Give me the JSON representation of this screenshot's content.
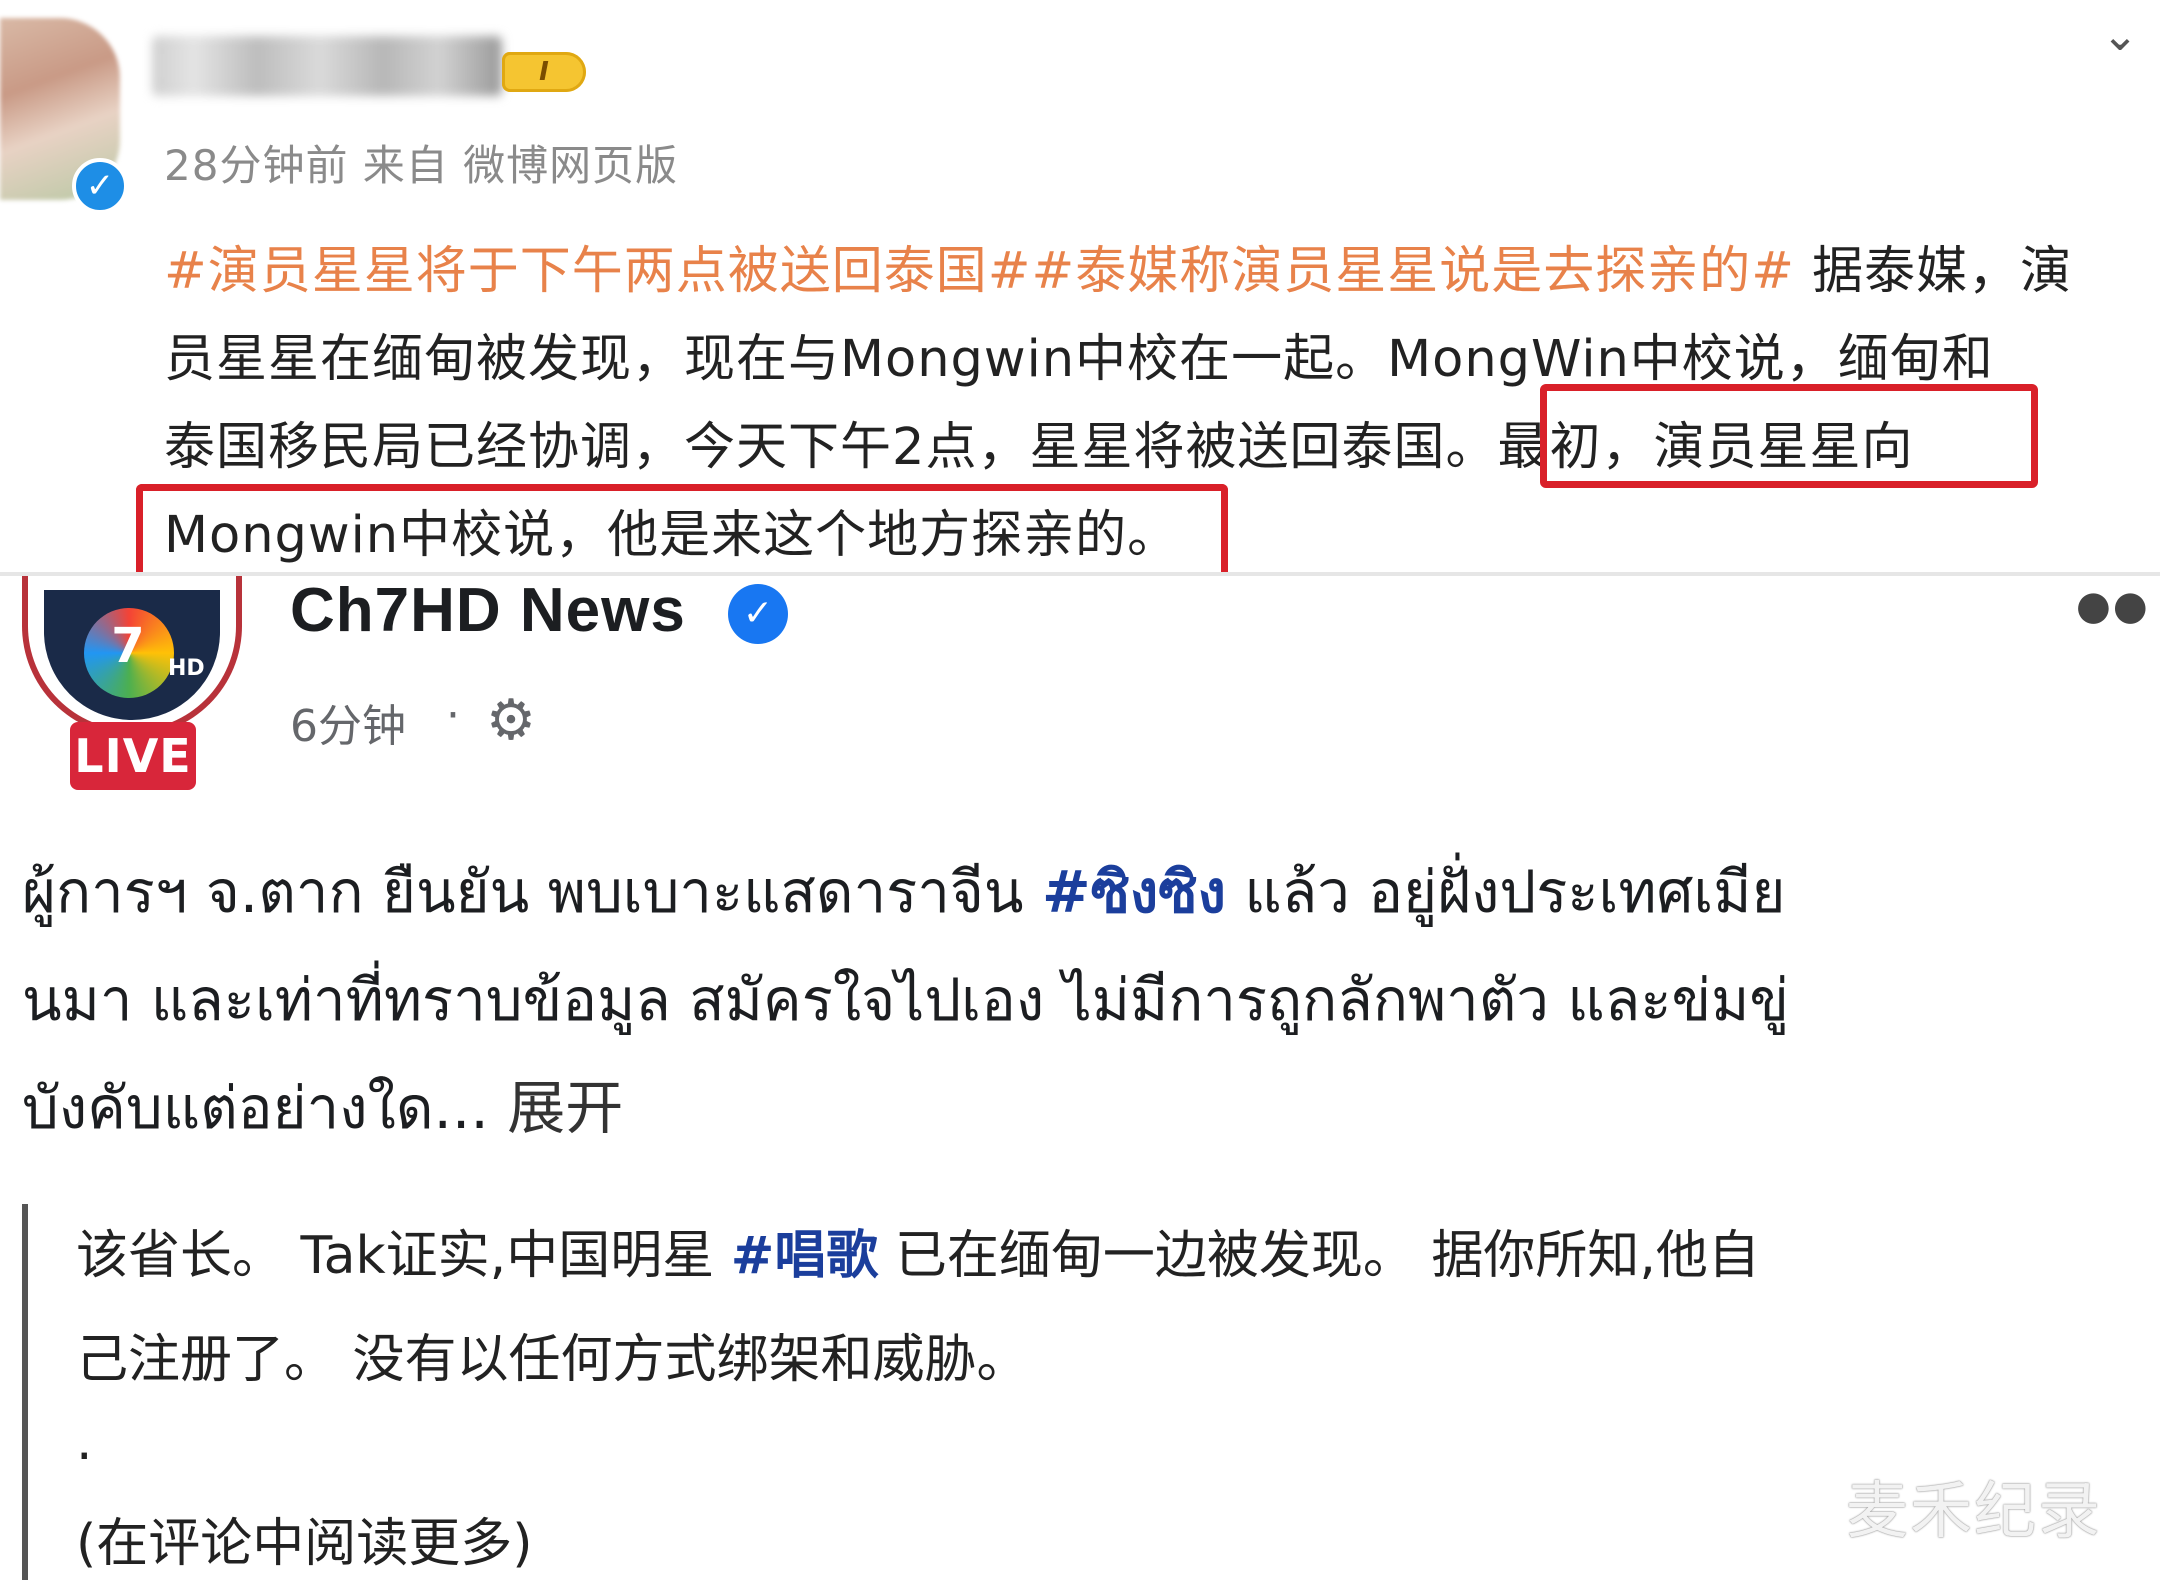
{
  "weibo": {
    "level_badge": "I",
    "meta": "28分钟前 来自 微博网页版",
    "lines": [
      {
        "hashtag": "#演员星星将于下午两点被送回泰国##泰媒称演员星星说是去探亲的#",
        "text": " 据泰媒，演"
      },
      {
        "text": "员星星在缅甸被发现，现在与Mongwin中校在一起。MongWin中校说，缅甸和"
      },
      {
        "text": "泰国移民局已经协调，今天下午2点，星星将被送回泰国。最初，演员星星向"
      },
      {
        "text": "Mongwin中校说，他是来这个地方探亲的。"
      }
    ]
  },
  "fb": {
    "live_label": "LIVE",
    "logo_number": "7",
    "logo_hd": "HD",
    "page_name": "Ch7HD News",
    "post_time": "6分钟",
    "time_separator": "·",
    "thai_line1_a": "ผู้การฯ จ.ตาก ยืนยัน พบเบาะแสดาราจีน ",
    "thai_hashtag": "#ซิงซิง",
    "thai_line1_b": " แล้ว อยู่ฝั่งประเทศเมีย",
    "thai_line2": "นมา และเท่าที่ทราบข้อมูล สมัครใจไปเอง ไม่มีการถูกลักพาตัว และข่มขู่",
    "thai_line3": "บังคับแต่อย่างใด...",
    "expand_label": " 展开",
    "tr_line1_a": "该省长。 Tak证实,中国明星 ",
    "tr_hashtag": "#唱歌",
    "tr_line1_b": " 已在缅甸一边被发现。 据你所知,他自",
    "tr_line2": "己注册了。 没有以任何方式绑架和威胁。",
    "tr_dot": ".",
    "read_more": "(在评论中阅读更多)"
  },
  "watermark": "麦禾纪录",
  "colors": {
    "weibo_hashtag": "#e8824a",
    "highlight_box": "#d92029",
    "fb_hashtag": "#1b3e9c",
    "verified_blue": "#1877f2",
    "live_red": "#d8263a"
  }
}
